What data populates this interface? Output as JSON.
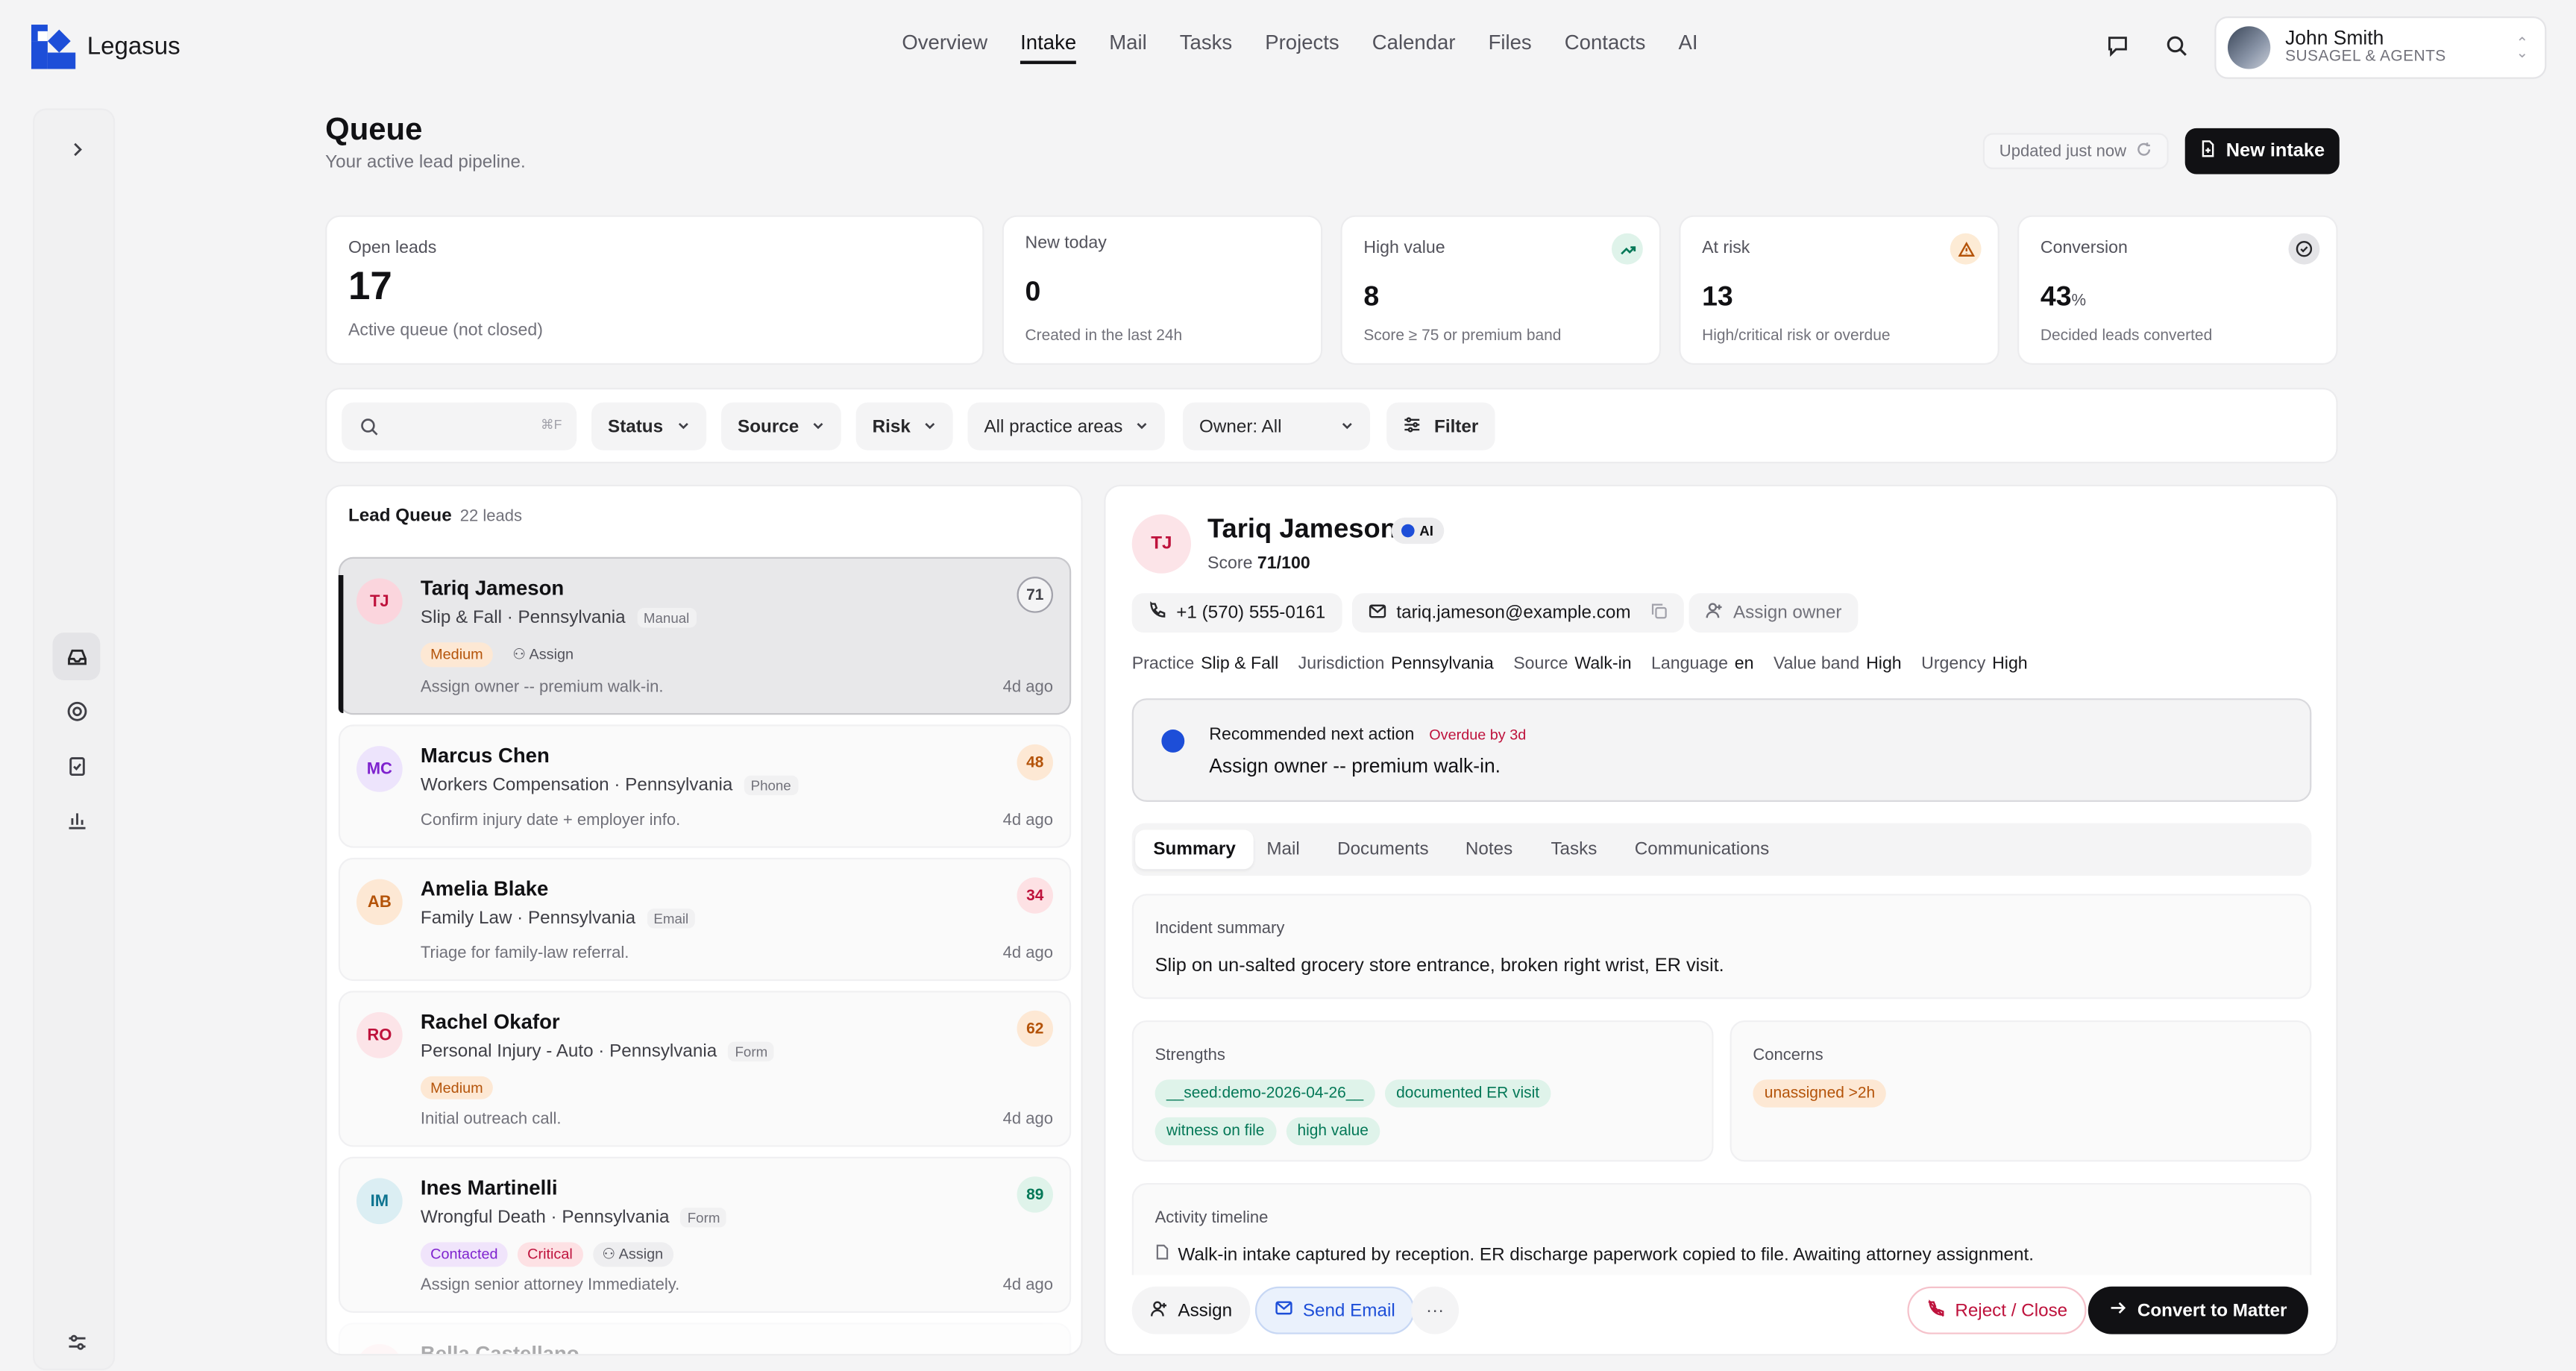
{
  "brand": {
    "name": "Legasus"
  },
  "nav": [
    "Overview",
    "Intake",
    "Mail",
    "Tasks",
    "Projects",
    "Calendar",
    "Files",
    "Contacts",
    "AI"
  ],
  "nav_active": "Intake",
  "user": {
    "name": "John Smith",
    "org": "SUSAGEL & AGENTS"
  },
  "header": {
    "title": "Queue",
    "subtitle": "Your active lead pipeline.",
    "updated": "Updated just now",
    "new_intake": "New intake"
  },
  "stats": [
    {
      "label": "Open leads",
      "value": "17",
      "sub": "Active queue (not closed)"
    },
    {
      "label": "New today",
      "value": "0",
      "sub": "Created in the last 24h"
    },
    {
      "label": "High value",
      "value": "8",
      "sub": "Score ≥ 75 or premium band",
      "icon": "trend-up-icon"
    },
    {
      "label": "At risk",
      "value": "13",
      "sub": "High/critical risk or overdue",
      "icon": "warning-icon"
    },
    {
      "label": "Conversion",
      "value": "43",
      "unit": "%",
      "sub": "Decided leads converted",
      "icon": "check-circle-icon"
    }
  ],
  "filters": {
    "search_kbd": "⌘F",
    "status": "Status",
    "source": "Source",
    "risk": "Risk",
    "practice": "All practice areas",
    "owner": "Owner: All",
    "filter": "Filter"
  },
  "queue": {
    "title": "Lead Queue",
    "count": "22 leads",
    "leads": [
      {
        "initials": "TJ",
        "name": "Tariq Jameson",
        "meta": "Slip & Fall · Pennsylvania",
        "channel": "Manual",
        "tags": [
          "Medium"
        ],
        "assign": "Assign",
        "note": "Assign owner -- premium walk-in.",
        "age": "4d ago",
        "score": "71"
      },
      {
        "initials": "MC",
        "name": "Marcus Chen",
        "meta": "Workers Compensation · Pennsylvania",
        "channel": "Phone",
        "note": "Confirm injury date + employer info.",
        "age": "4d ago",
        "score": "48"
      },
      {
        "initials": "AB",
        "name": "Amelia Blake",
        "meta": "Family Law · Pennsylvania",
        "channel": "Email",
        "note": "Triage for family-law referral.",
        "age": "4d ago",
        "score": "34"
      },
      {
        "initials": "RO",
        "name": "Rachel Okafor",
        "meta": "Personal Injury - Auto · Pennsylvania",
        "channel": "Form",
        "tags": [
          "Medium"
        ],
        "note": "Initial outreach call.",
        "age": "4d ago",
        "score": "62"
      },
      {
        "initials": "IM",
        "name": "Ines Martinelli",
        "meta": "Wrongful Death · Pennsylvania",
        "channel": "Form",
        "tags": [
          "Contacted",
          "Critical"
        ],
        "assign": "Assign",
        "note": "Assign senior attorney Immediately.",
        "age": "4d ago",
        "score": "89"
      },
      {
        "initials": "BC",
        "name": "Bella Castellano",
        "score": ""
      }
    ]
  },
  "detail": {
    "initials": "TJ",
    "name": "Tariq Jameson",
    "ai_badge": "AI",
    "score_label": "Score",
    "score_value": "71/100",
    "phone": "+1 (570) 555-0161",
    "email": "tariq.jameson@example.com",
    "assign_owner": "Assign owner",
    "facts": [
      {
        "k": "Practice",
        "v": "Slip & Fall"
      },
      {
        "k": "Jurisdiction",
        "v": "Pennsylvania"
      },
      {
        "k": "Source",
        "v": "Walk-in"
      },
      {
        "k": "Language",
        "v": "en"
      },
      {
        "k": "Value band",
        "v": "High"
      },
      {
        "k": "Urgency",
        "v": "High"
      }
    ],
    "recommendation": {
      "title": "Recommended next action",
      "overdue": "Overdue by 3d",
      "text": "Assign owner -- premium walk-in."
    },
    "tabs": [
      "Summary",
      "Mail",
      "Documents",
      "Notes",
      "Tasks",
      "Communications"
    ],
    "incident": {
      "label": "Incident summary",
      "text": "Slip on un-salted grocery store entrance, broken right wrist, ER visit."
    },
    "strengths": {
      "label": "Strengths",
      "chips": [
        "__seed:demo-2026-04-26__",
        "documented ER visit",
        "witness on file",
        "high value"
      ]
    },
    "concerns": {
      "label": "Concerns",
      "chips": [
        "unassigned >2h"
      ]
    },
    "timeline": {
      "label": "Activity timeline",
      "item": "Walk-in intake captured by reception. ER discharge paperwork copied to file. Awaiting attorney assignment."
    },
    "actions": {
      "assign": "Assign",
      "send_email": "Send Email",
      "more": "···",
      "reject": "Reject / Close",
      "convert": "Convert to Matter"
    }
  },
  "colors": {
    "primary": "#111114",
    "accent_blue": "#1d4ed8",
    "success": "#047857",
    "warning": "#b45309",
    "danger": "#be123c",
    "background": "#f4f4f5"
  }
}
